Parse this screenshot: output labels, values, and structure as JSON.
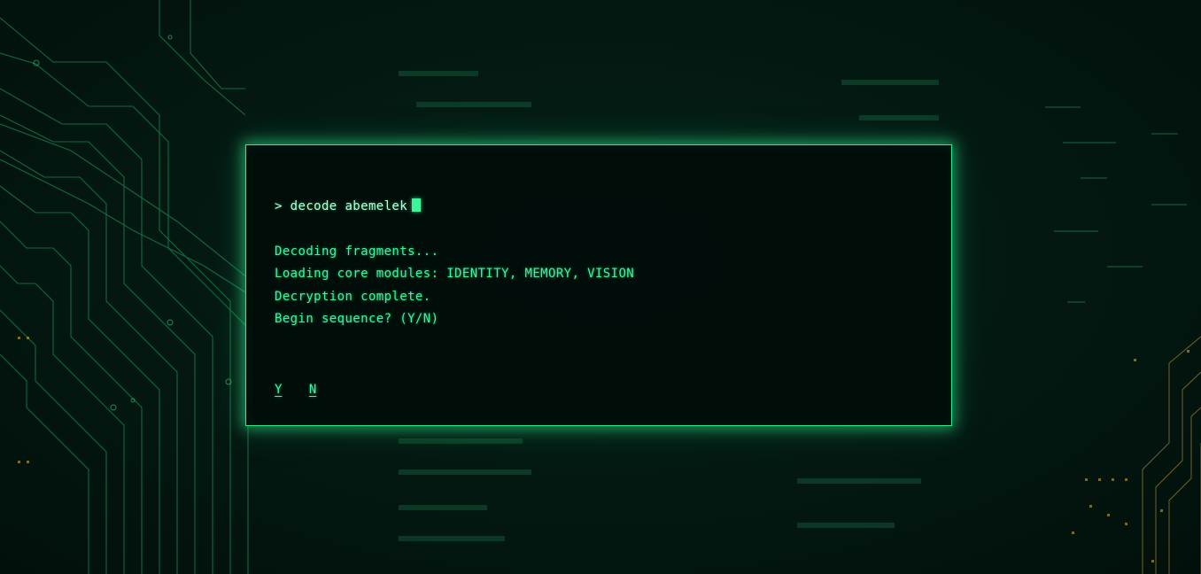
{
  "terminal": {
    "prompt": "> decode abemelek",
    "output": [
      "Decoding fragments...",
      "Loading core modules: IDENTITY, MEMORY, VISION",
      "Decryption complete.",
      "Begin sequence? (Y/N)"
    ],
    "choices": {
      "yes": "Y",
      "no": "N"
    }
  },
  "colors": {
    "accent": "#3cf59a",
    "border": "#2ee88c",
    "background": "#03120d"
  },
  "icons": {
    "caret": "block-cursor-icon"
  }
}
